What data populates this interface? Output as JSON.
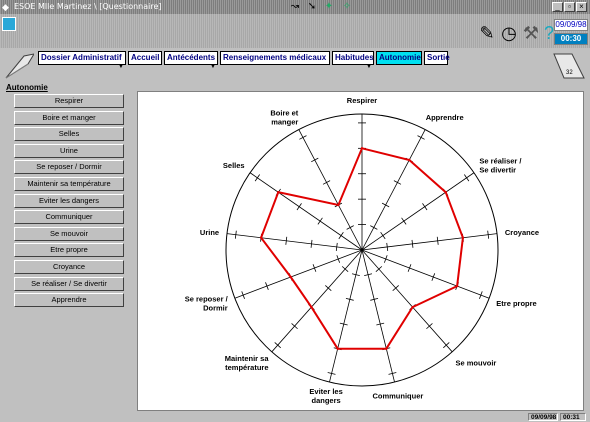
{
  "window": {
    "title": "ESOE Mlle Martinez \\ [Questionnaire]",
    "date": "09/09/98",
    "time": "00:30"
  },
  "tabs": [
    {
      "label": "Dossier Administratif",
      "active": false,
      "has_caret": true
    },
    {
      "label": "Accueil",
      "active": false,
      "has_caret": false
    },
    {
      "label": "Antécédents",
      "active": false,
      "has_caret": true
    },
    {
      "label": "Renseignements médicaux",
      "active": false,
      "has_caret": false
    },
    {
      "label": "Habitudes",
      "active": false,
      "has_caret": true
    },
    {
      "label": "Autonomie",
      "active": true,
      "has_caret": false
    },
    {
      "label": "Sortie",
      "active": false,
      "has_caret": false
    }
  ],
  "section": {
    "title": "Autonomie"
  },
  "needs_buttons": [
    "Respirer",
    "Boire et manger",
    "Selles",
    "Urine",
    "Se reposer / Dormir",
    "Maintenir sa température",
    "Eviter les dangers",
    "Communiquer",
    "Se mouvoir",
    "Etre propre",
    "Croyance",
    "Se réaliser / Se divertir",
    "Apprendre"
  ],
  "chart_data": {
    "type": "radar",
    "series_color": "#e00000",
    "axes": [
      "Respirer",
      "Apprendre",
      "Se réaliser / Se divertir",
      "Croyance",
      "Etre propre",
      "Se mouvoir",
      "Communiquer",
      "Eviter les dangers",
      "Maintenir sa température",
      "Se reposer / Dormir",
      "Urine",
      "Selles",
      "Boire et manger"
    ],
    "scale_max": 5,
    "values": [
      4,
      4,
      4,
      4,
      4,
      3,
      4,
      4,
      3,
      3,
      4,
      4,
      2
    ]
  },
  "status": {
    "date": "09/09/98",
    "time": "00:31"
  },
  "icons": {
    "toolbar": [
      "spray-icon",
      "clock-icon",
      "tools-icon",
      "help-icon"
    ],
    "title": [
      "route-icon",
      "pin-icon",
      "tool-icon"
    ]
  }
}
